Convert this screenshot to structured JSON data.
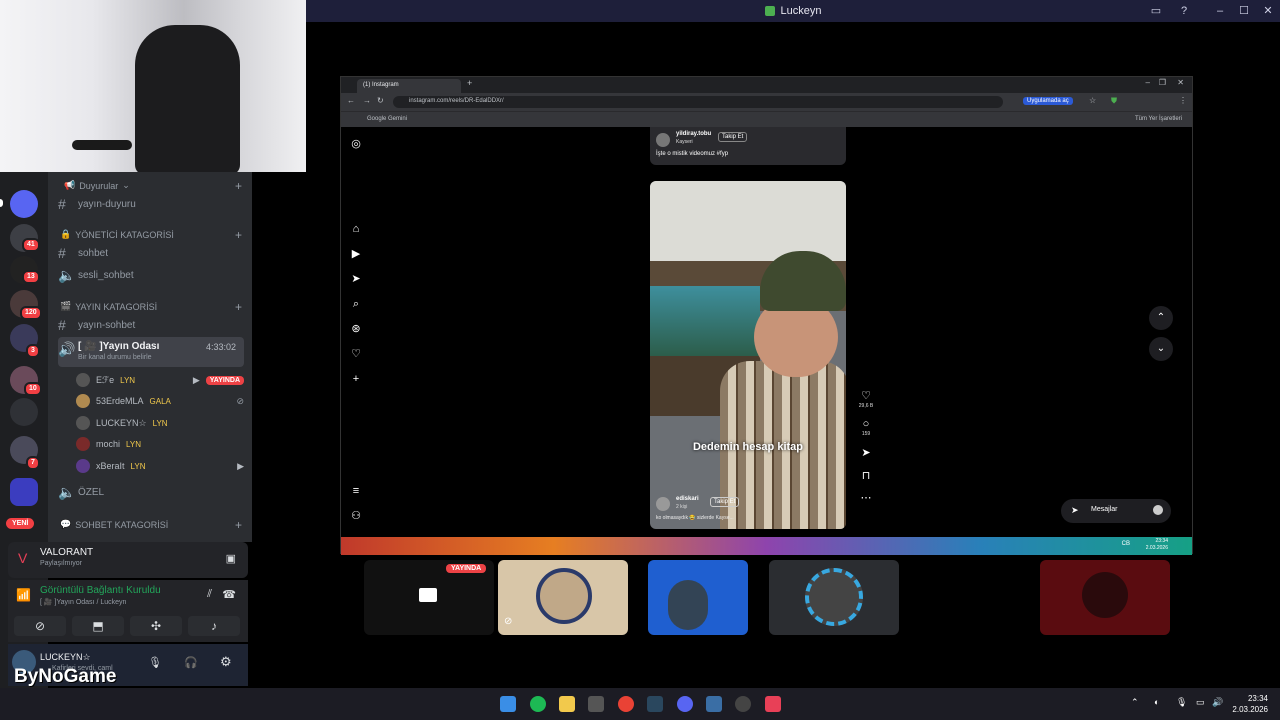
{
  "window": {
    "title": "Luckeyn"
  },
  "servers": {
    "badges": [
      "41",
      "13",
      "120",
      "3",
      "10",
      "7"
    ],
    "new_label": "YENİ"
  },
  "channels": {
    "announcements_cat": "Duyurular",
    "announcements_ch": "yayın-duyuru",
    "admin_cat": "YÖNETİCİ KATAGORİSİ",
    "admin_text": "sohbet",
    "admin_voice": "sesli_sohbet",
    "stream_cat": "YAYIN KATAGORİSİ",
    "stream_text": "yayın-sohbet",
    "voice_room": "[ 🎥 ]Yayın Odası",
    "voice_status": "Bir kanal durumu belirle",
    "voice_timer": "4:33:02",
    "users": [
      {
        "name": "Eℱe",
        "tag": "LYN",
        "live": "YAYINDA"
      },
      {
        "name": "53ErdeMLA",
        "tag": "GALA"
      },
      {
        "name": "LUCKEYN☆",
        "tag": "LYN"
      },
      {
        "name": "mochi",
        "tag": "LYN"
      },
      {
        "name": "xBeraIt",
        "tag": "LYN"
      }
    ],
    "private_ch": "ÖZEL",
    "chat_cat": "SOHBET KATAGORİSİ"
  },
  "activity": {
    "game": "VALORANT",
    "sub": "Paylaşılmıyor"
  },
  "voice_conn": {
    "status": "Görüntülü Bağlantı Kuruldu",
    "channel": "[ 🎥 ]Yayın Odası / Luckeyn"
  },
  "userbar": {
    "name": "LUCKEYN☆",
    "sub": "Kafirleri sevdi, caml"
  },
  "browser": {
    "tab": "(1) Instagram",
    "url": "instagram.com/reels/DR-EdalDDXr/",
    "open_app": "Uygulamada aç",
    "bookmark": "Google Gemini",
    "all_bookmarks": "Tüm Yer İşaretleri"
  },
  "reel": {
    "top_user": "yildiray.tobu",
    "top_location": "Kayseri",
    "follow": "Takip Et",
    "top_caption": "İşte o mistik videomuz #fyp",
    "caption": "Dedemin hesap kitap",
    "bottom_user": "ediskari",
    "bottom_follow": "Takip Et",
    "bottom_meta": "2 kişi",
    "bottom_caption": "ko olmasaydık 😂 sizlerde Kayse...",
    "likes": "29,6 B",
    "comments": "159",
    "messages": "Mesajlar"
  },
  "tiles": {
    "live": "YAYINDA"
  },
  "watermark": "ByNoGame",
  "clock": {
    "time": "23:34",
    "date": "2.03.2026"
  },
  "inner_clock": {
    "time": "23:34",
    "date": "2.03.2026",
    "lang": "CB"
  }
}
